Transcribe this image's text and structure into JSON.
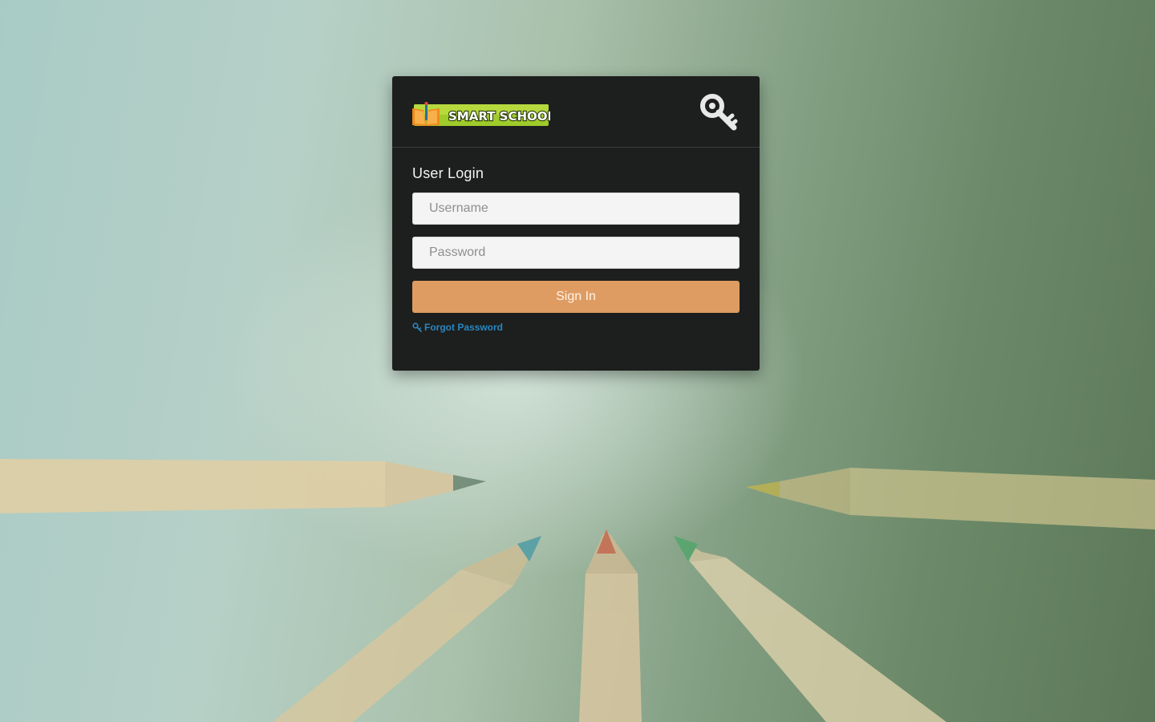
{
  "brand": {
    "logo_text": "SMART SCHOOL",
    "accent_color": "#de9c62",
    "link_color": "#2a86c1"
  },
  "login": {
    "title": "User Login",
    "username_placeholder": "Username",
    "password_placeholder": "Password",
    "sign_in_label": "Sign In",
    "forgot_password_label": "Forgot Password"
  },
  "icons": {
    "header": "key-icon",
    "forgot": "key-icon"
  }
}
